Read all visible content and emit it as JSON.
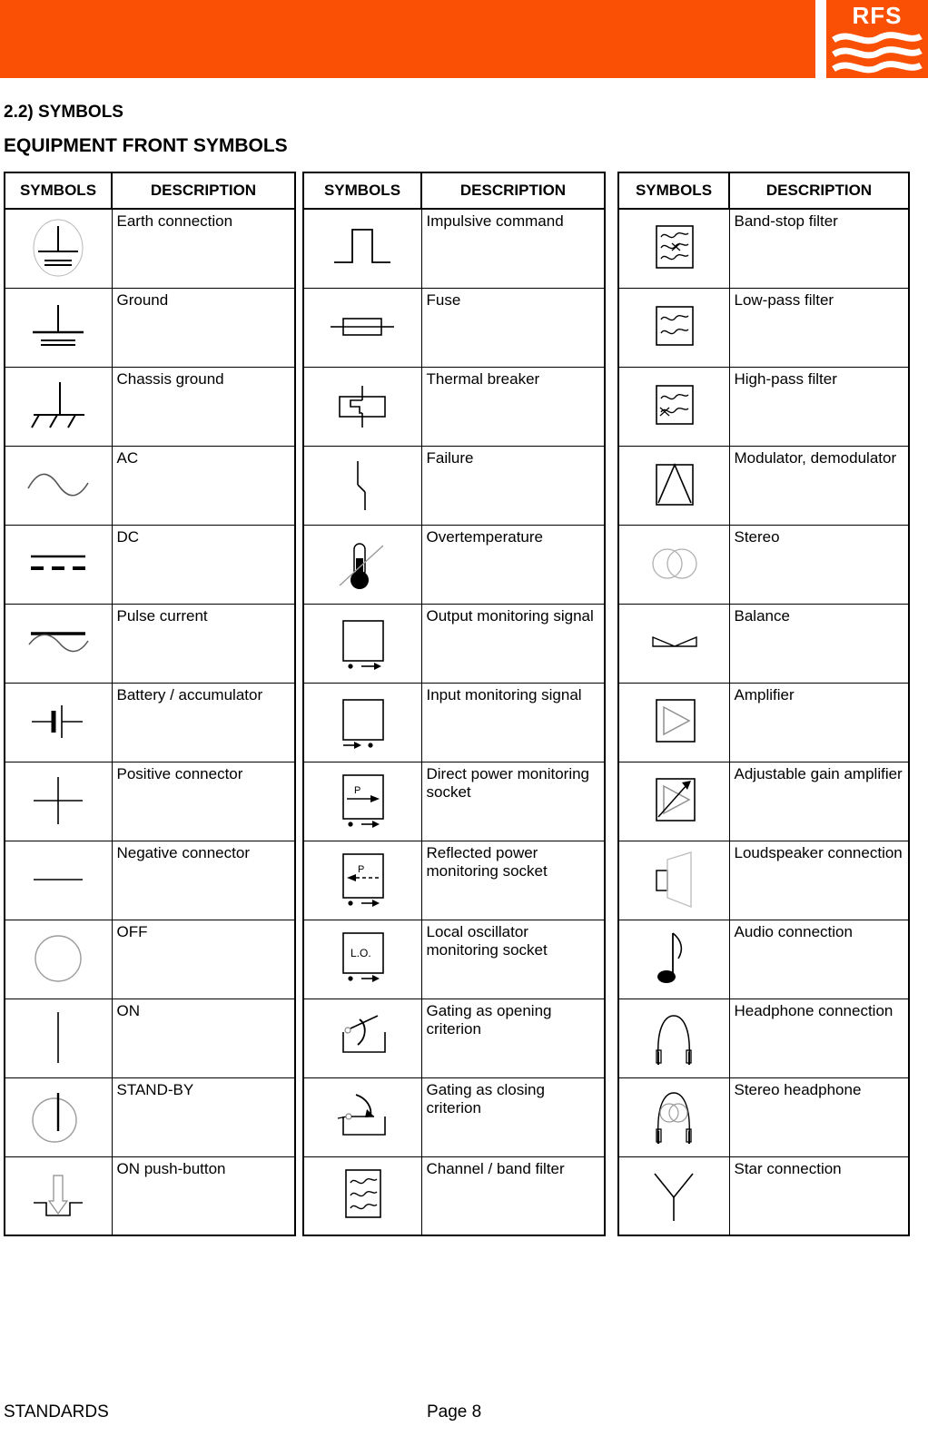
{
  "header": {
    "logo_text": "RFS",
    "logo_icon": "rfs-waves-logo",
    "band_color": "#fa5005"
  },
  "headings": {
    "section": "2.2) SYMBOLS",
    "subsection": "EQUIPMENT FRONT SYMBOLS"
  },
  "table_headers": {
    "symbols": "SYMBOLS",
    "description": "DESCRIPTION"
  },
  "tables": [
    {
      "id": "table-1",
      "rows": [
        {
          "icon": "earth-connection-icon",
          "description": "Earth connection"
        },
        {
          "icon": "ground-icon",
          "description": "Ground"
        },
        {
          "icon": "chassis-ground-icon",
          "description": "Chassis ground"
        },
        {
          "icon": "ac-icon",
          "description": "AC"
        },
        {
          "icon": "dc-icon",
          "description": "DC"
        },
        {
          "icon": "pulse-current-icon",
          "description": "Pulse current"
        },
        {
          "icon": "battery-icon",
          "description": "Battery / accumulator"
        },
        {
          "icon": "positive-connector-icon",
          "description": "Positive connector"
        },
        {
          "icon": "negative-connector-icon",
          "description": "Negative connector"
        },
        {
          "icon": "off-icon",
          "description": "OFF"
        },
        {
          "icon": "on-icon",
          "description": "ON"
        },
        {
          "icon": "stand-by-icon",
          "description": "STAND-BY"
        },
        {
          "icon": "on-push-button-icon",
          "description": "ON push-button"
        }
      ]
    },
    {
      "id": "table-2",
      "rows": [
        {
          "icon": "impulsive-command-icon",
          "description": "Impulsive command"
        },
        {
          "icon": "fuse-icon",
          "description": "Fuse"
        },
        {
          "icon": "thermal-breaker-icon",
          "description": "Thermal breaker"
        },
        {
          "icon": "failure-icon",
          "description": "Failure"
        },
        {
          "icon": "overtemperature-icon",
          "description": "Overtemperature"
        },
        {
          "icon": "output-monitoring-signal-icon",
          "description": "Output monitoring signal"
        },
        {
          "icon": "input-monitoring-signal-icon",
          "description": "Input monitoring signal"
        },
        {
          "icon": "direct-power-socket-icon",
          "description": "Direct power monitoring socket"
        },
        {
          "icon": "reflected-power-socket-icon",
          "description": "Reflected power monitoring socket"
        },
        {
          "icon": "local-oscillator-socket-icon",
          "description": "Local oscillator monitoring socket"
        },
        {
          "icon": "gating-opening-icon",
          "description": "Gating as opening criterion"
        },
        {
          "icon": "gating-closing-icon",
          "description": "Gating as closing criterion"
        },
        {
          "icon": "channel-band-filter-icon",
          "description": "Channel / band filter"
        }
      ]
    },
    {
      "id": "table-3",
      "rows": [
        {
          "icon": "band-stop-filter-icon",
          "description": "Band-stop filter"
        },
        {
          "icon": "low-pass-filter-icon",
          "description": "Low-pass filter"
        },
        {
          "icon": "high-pass-filter-icon",
          "description": "High-pass filter"
        },
        {
          "icon": "modulator-icon",
          "description": "Modulator, demodulator"
        },
        {
          "icon": "stereo-icon",
          "description": "Stereo"
        },
        {
          "icon": "balance-icon",
          "description": "Balance"
        },
        {
          "icon": "amplifier-icon",
          "description": "Amplifier"
        },
        {
          "icon": "adjustable-gain-amp-icon",
          "description": "Adjustable gain amplifier"
        },
        {
          "icon": "loudspeaker-icon",
          "description": "Loudspeaker connection"
        },
        {
          "icon": "audio-connection-icon",
          "description": "Audio connection"
        },
        {
          "icon": "headphone-icon",
          "description": "Headphone connection"
        },
        {
          "icon": "stereo-headphone-icon",
          "description": "Stereo headphone"
        },
        {
          "icon": "star-connection-icon",
          "description": "Star connection"
        }
      ]
    }
  ],
  "socket_labels": {
    "direct_power": "P",
    "reflected_power": "P",
    "local_oscillator": "L.O."
  },
  "footer": {
    "left": "STANDARDS",
    "page": "Page 8"
  }
}
